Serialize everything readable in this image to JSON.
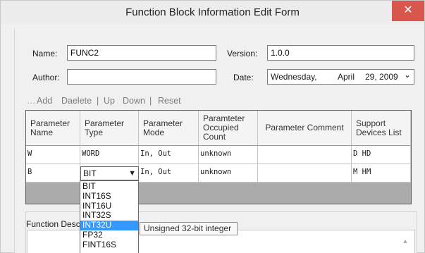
{
  "window": {
    "title": "Function Block Information Edit Form",
    "close_glyph": "✕"
  },
  "form": {
    "name_label": "Name:",
    "name_value": "FUNC2",
    "version_label": "Version:",
    "version_value": "1.0.0",
    "author_label": "Author:",
    "author_value": "",
    "date_label": "Date:",
    "date": {
      "weekday": "Wednesday,",
      "month": "April",
      "day_year": "29, 2009",
      "dropdown_glyph": "⌄"
    }
  },
  "toolbar": {
    "grip": "…",
    "add": "Add",
    "delete": "Daelete",
    "sep1": "|",
    "up": "Up",
    "down": "Down",
    "sep2": "|",
    "reset": "Reset"
  },
  "grid": {
    "headers": {
      "name": "Parameter Name",
      "type": "Parameter Type",
      "mode": "Parameter Mode",
      "count": "Paramteter Occupied Count",
      "comment": "Parameter Comment",
      "devices": "Support Devices List"
    },
    "rows": [
      {
        "name": "W",
        "type": "WORD",
        "mode": "In, Out",
        "count": "unknown",
        "comment": "",
        "devices": "D HD"
      },
      {
        "name": "B",
        "type": "BIT",
        "mode": "In, Out",
        "count": "unknown",
        "comment": "",
        "devices": "M HM"
      }
    ],
    "combo_arrow": "▼"
  },
  "type_dropdown": {
    "options": [
      "BIT",
      "INT16S",
      "INT16U",
      "INT32S",
      "INT32U",
      "FP32",
      "FINT16S"
    ],
    "highlighted": "INT32U"
  },
  "tooltip": {
    "text": "Unsigned 32-bit integer"
  },
  "description": {
    "label": "Function Description",
    "scroll_up_glyph": "▲"
  }
}
